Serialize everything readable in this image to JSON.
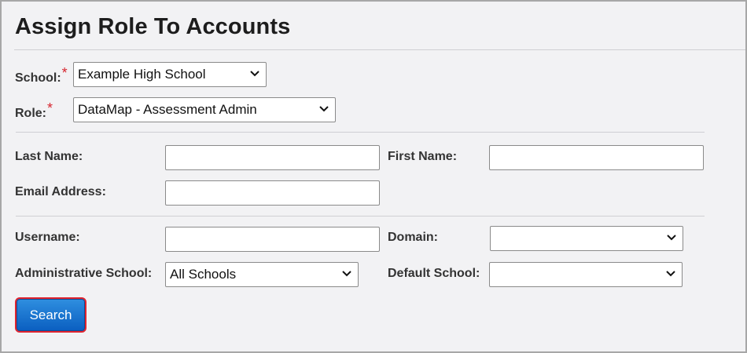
{
  "page": {
    "title": "Assign Role To Accounts"
  },
  "form": {
    "required_mark": "*",
    "school": {
      "label": "School:",
      "value": "Example High School"
    },
    "role": {
      "label": "Role:",
      "value": "DataMap - Assessment Admin"
    },
    "last_name": {
      "label": "Last Name:",
      "value": ""
    },
    "first_name": {
      "label": "First Name:",
      "value": ""
    },
    "email": {
      "label": "Email Address:",
      "value": ""
    },
    "username": {
      "label": "Username:",
      "value": ""
    },
    "domain": {
      "label": "Domain:",
      "value": ""
    },
    "admin_school": {
      "label": "Administrative School:",
      "value": "All Schools"
    },
    "default_school": {
      "label": "Default School:",
      "value": ""
    },
    "search_label": "Search"
  },
  "colors": {
    "accent": "#0a5ec0",
    "required": "#d6262f",
    "focus_outline": "#e0242f"
  },
  "icons": {
    "dropdown": "chevron-down-icon"
  }
}
